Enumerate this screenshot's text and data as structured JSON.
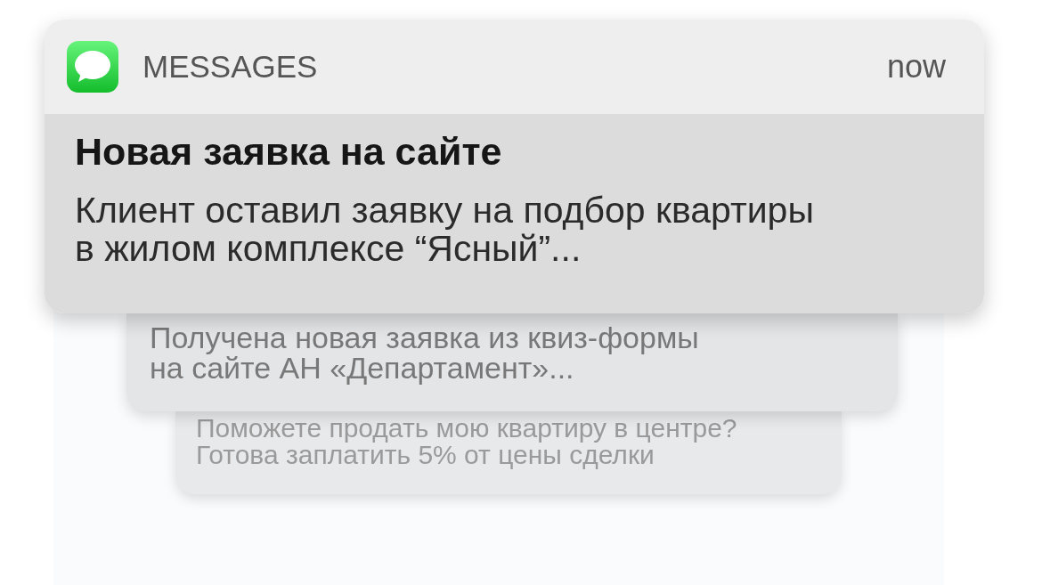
{
  "notification": {
    "app_name": "MESSAGES",
    "time": "now",
    "title": "Новая заявка на сайте",
    "message": "Клиент оставил заявку на подбор квартиры\nв жилом комплексе “Ясный”..."
  },
  "stacked_notifications": [
    {
      "message": "Получена новая заявка из квиз-формы\nна сайте АН «Департамент»..."
    },
    {
      "message": "Поможете продать мою квартиру в центре?\nГотова заплатить 5% от цены сделки"
    }
  ]
}
